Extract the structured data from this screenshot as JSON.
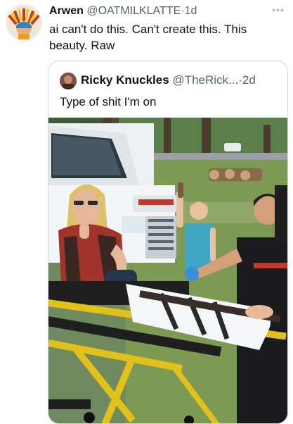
{
  "post": {
    "author_name": "Arwen",
    "handle": "@OATMILKLATTE",
    "separator": "·",
    "time": "1d",
    "text": "ai can't do this. Can't create this. This beauty. Raw",
    "more_icon": "ellipsis-icon"
  },
  "quote": {
    "author_name": "Ricky Knuckles",
    "handle": "@TheRick...",
    "separator": "·",
    "time": "2d",
    "text": "Type of shit I'm on",
    "media": "photo: woman on ambulance stretcher with paramedic and boy"
  }
}
